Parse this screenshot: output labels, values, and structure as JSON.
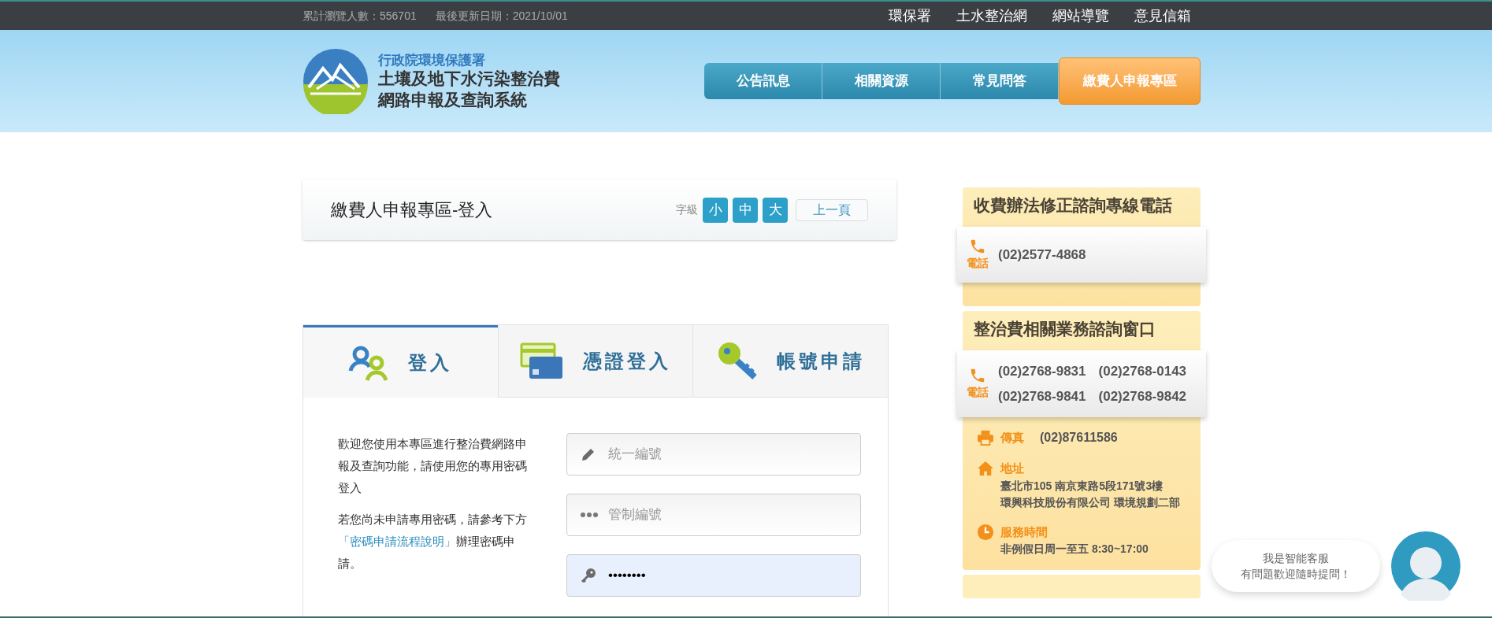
{
  "top_bar": {
    "visitor_count": "累計瀏覽人數：556701",
    "last_updated": "最後更新日期：2021/10/01",
    "links": [
      "環保署",
      "土水整治網",
      "網站導覽",
      "意見信箱"
    ]
  },
  "header": {
    "agency": "行政院環境保護署",
    "title_lines": [
      "土壤及地下水污染整治費",
      "網路申報及查詢系統"
    ],
    "nav": [
      {
        "label": "公告訊息",
        "selected": false
      },
      {
        "label": "相關資源",
        "selected": false
      },
      {
        "label": "常見問答",
        "selected": false
      },
      {
        "label": "繳費人申報專區",
        "selected": true
      }
    ]
  },
  "page_title": "繳費人申報專區-登入",
  "font_size": {
    "label": "字級",
    "options": [
      "小",
      "中",
      "大"
    ]
  },
  "back_button": "上一頁",
  "login_tabs": [
    {
      "label": "登入",
      "kind": "people",
      "selected": true
    },
    {
      "label": "憑證登入",
      "kind": "card",
      "selected": false
    },
    {
      "label": "帳號申請",
      "kind": "key",
      "selected": false
    }
  ],
  "intro": {
    "text": "歡迎您使用本專區進行整治費網路申報及查詢功能，請使用您的專用密碼登入",
    "before_link": "若您尚未申請專用密碼，請參考下方",
    "link": "「密碼申請流程說明」",
    "after_link": "辦理密碼申請。"
  },
  "fields": [
    {
      "kind": "pencil",
      "placeholder": "統一編號"
    },
    {
      "kind": "dots",
      "placeholder": "管制編號"
    },
    {
      "kind": "key",
      "value": "••••••••"
    }
  ],
  "sidebar": [
    {
      "title": "收費辦法修正諮詢專線電話",
      "phone_label": "電話",
      "phones": [
        "(02)2577-4868"
      ]
    },
    {
      "title": "整治費相關業務諮詢窗口",
      "phone_label": "電話",
      "phones": [
        "(02)2768-9831",
        "(02)2768-0143",
        "(02)2768-9841",
        "(02)2768-9842"
      ],
      "details": [
        {
          "kind": "fax",
          "label": "傳真",
          "lines": [
            "(02)87611586"
          ]
        },
        {
          "kind": "address",
          "label": "地址",
          "lines": [
            "臺北市105 南京東路5段171號3樓",
            "環興科技股份有限公司 環境規劃二部"
          ]
        },
        {
          "kind": "hours",
          "label": "服務時間",
          "lines": [
            "非例假日周一至五 8:30~17:00"
          ]
        }
      ]
    }
  ],
  "chat": {
    "lines": [
      "我是智能客服",
      "有問題歡迎隨時提問！"
    ]
  }
}
